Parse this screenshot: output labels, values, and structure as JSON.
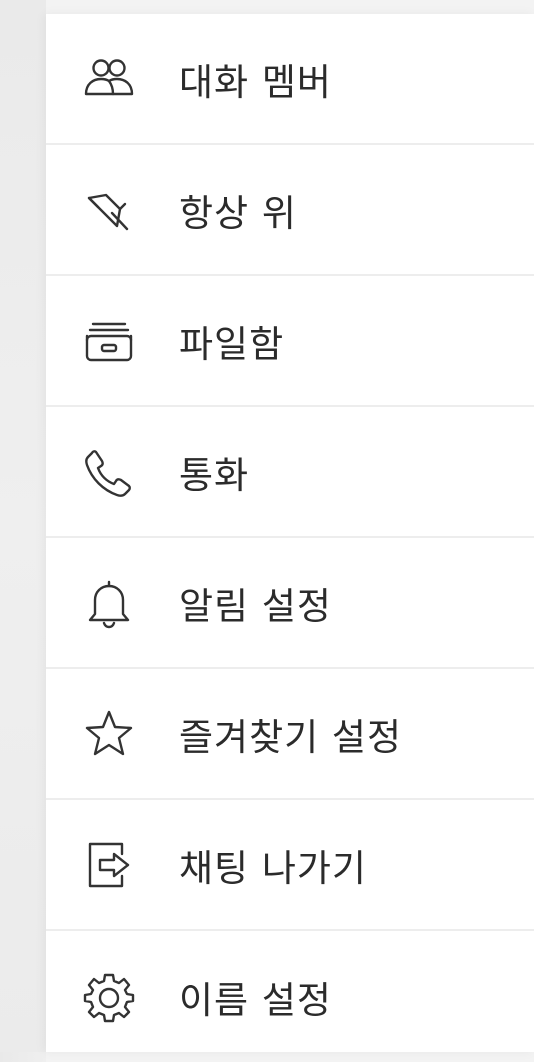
{
  "menu": {
    "items": [
      {
        "label": "대화 멤버",
        "icon": "members-icon"
      },
      {
        "label": "항상 위",
        "icon": "pin-icon"
      },
      {
        "label": "파일함",
        "icon": "file-box-icon"
      },
      {
        "label": "통화",
        "icon": "phone-icon"
      },
      {
        "label": "알림 설정",
        "icon": "bell-icon"
      },
      {
        "label": "즐겨찾기 설정",
        "icon": "star-icon"
      },
      {
        "label": "채팅 나가기",
        "icon": "exit-icon"
      },
      {
        "label": "이름 설정",
        "icon": "gear-icon"
      }
    ]
  },
  "colors": {
    "text": "#2b2b2b",
    "icon_stroke": "#333333",
    "divider": "#ededed",
    "panel": "#ffffff",
    "backdrop": "#eeeeee"
  }
}
